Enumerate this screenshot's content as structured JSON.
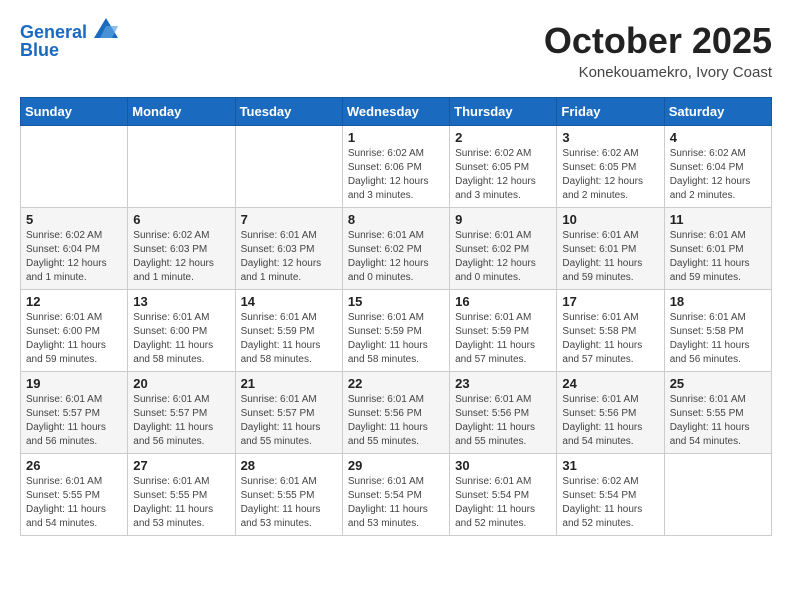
{
  "header": {
    "logo_line1": "General",
    "logo_line2": "Blue",
    "month": "October 2025",
    "location": "Konekouamekro, Ivory Coast"
  },
  "weekdays": [
    "Sunday",
    "Monday",
    "Tuesday",
    "Wednesday",
    "Thursday",
    "Friday",
    "Saturday"
  ],
  "weeks": [
    [
      {
        "day": "",
        "info": ""
      },
      {
        "day": "",
        "info": ""
      },
      {
        "day": "",
        "info": ""
      },
      {
        "day": "1",
        "info": "Sunrise: 6:02 AM\nSunset: 6:06 PM\nDaylight: 12 hours\nand 3 minutes."
      },
      {
        "day": "2",
        "info": "Sunrise: 6:02 AM\nSunset: 6:05 PM\nDaylight: 12 hours\nand 3 minutes."
      },
      {
        "day": "3",
        "info": "Sunrise: 6:02 AM\nSunset: 6:05 PM\nDaylight: 12 hours\nand 2 minutes."
      },
      {
        "day": "4",
        "info": "Sunrise: 6:02 AM\nSunset: 6:04 PM\nDaylight: 12 hours\nand 2 minutes."
      }
    ],
    [
      {
        "day": "5",
        "info": "Sunrise: 6:02 AM\nSunset: 6:04 PM\nDaylight: 12 hours\nand 1 minute."
      },
      {
        "day": "6",
        "info": "Sunrise: 6:02 AM\nSunset: 6:03 PM\nDaylight: 12 hours\nand 1 minute."
      },
      {
        "day": "7",
        "info": "Sunrise: 6:01 AM\nSunset: 6:03 PM\nDaylight: 12 hours\nand 1 minute."
      },
      {
        "day": "8",
        "info": "Sunrise: 6:01 AM\nSunset: 6:02 PM\nDaylight: 12 hours\nand 0 minutes."
      },
      {
        "day": "9",
        "info": "Sunrise: 6:01 AM\nSunset: 6:02 PM\nDaylight: 12 hours\nand 0 minutes."
      },
      {
        "day": "10",
        "info": "Sunrise: 6:01 AM\nSunset: 6:01 PM\nDaylight: 11 hours\nand 59 minutes."
      },
      {
        "day": "11",
        "info": "Sunrise: 6:01 AM\nSunset: 6:01 PM\nDaylight: 11 hours\nand 59 minutes."
      }
    ],
    [
      {
        "day": "12",
        "info": "Sunrise: 6:01 AM\nSunset: 6:00 PM\nDaylight: 11 hours\nand 59 minutes."
      },
      {
        "day": "13",
        "info": "Sunrise: 6:01 AM\nSunset: 6:00 PM\nDaylight: 11 hours\nand 58 minutes."
      },
      {
        "day": "14",
        "info": "Sunrise: 6:01 AM\nSunset: 5:59 PM\nDaylight: 11 hours\nand 58 minutes."
      },
      {
        "day": "15",
        "info": "Sunrise: 6:01 AM\nSunset: 5:59 PM\nDaylight: 11 hours\nand 58 minutes."
      },
      {
        "day": "16",
        "info": "Sunrise: 6:01 AM\nSunset: 5:59 PM\nDaylight: 11 hours\nand 57 minutes."
      },
      {
        "day": "17",
        "info": "Sunrise: 6:01 AM\nSunset: 5:58 PM\nDaylight: 11 hours\nand 57 minutes."
      },
      {
        "day": "18",
        "info": "Sunrise: 6:01 AM\nSunset: 5:58 PM\nDaylight: 11 hours\nand 56 minutes."
      }
    ],
    [
      {
        "day": "19",
        "info": "Sunrise: 6:01 AM\nSunset: 5:57 PM\nDaylight: 11 hours\nand 56 minutes."
      },
      {
        "day": "20",
        "info": "Sunrise: 6:01 AM\nSunset: 5:57 PM\nDaylight: 11 hours\nand 56 minutes."
      },
      {
        "day": "21",
        "info": "Sunrise: 6:01 AM\nSunset: 5:57 PM\nDaylight: 11 hours\nand 55 minutes."
      },
      {
        "day": "22",
        "info": "Sunrise: 6:01 AM\nSunset: 5:56 PM\nDaylight: 11 hours\nand 55 minutes."
      },
      {
        "day": "23",
        "info": "Sunrise: 6:01 AM\nSunset: 5:56 PM\nDaylight: 11 hours\nand 55 minutes."
      },
      {
        "day": "24",
        "info": "Sunrise: 6:01 AM\nSunset: 5:56 PM\nDaylight: 11 hours\nand 54 minutes."
      },
      {
        "day": "25",
        "info": "Sunrise: 6:01 AM\nSunset: 5:55 PM\nDaylight: 11 hours\nand 54 minutes."
      }
    ],
    [
      {
        "day": "26",
        "info": "Sunrise: 6:01 AM\nSunset: 5:55 PM\nDaylight: 11 hours\nand 54 minutes."
      },
      {
        "day": "27",
        "info": "Sunrise: 6:01 AM\nSunset: 5:55 PM\nDaylight: 11 hours\nand 53 minutes."
      },
      {
        "day": "28",
        "info": "Sunrise: 6:01 AM\nSunset: 5:55 PM\nDaylight: 11 hours\nand 53 minutes."
      },
      {
        "day": "29",
        "info": "Sunrise: 6:01 AM\nSunset: 5:54 PM\nDaylight: 11 hours\nand 53 minutes."
      },
      {
        "day": "30",
        "info": "Sunrise: 6:01 AM\nSunset: 5:54 PM\nDaylight: 11 hours\nand 52 minutes."
      },
      {
        "day": "31",
        "info": "Sunrise: 6:02 AM\nSunset: 5:54 PM\nDaylight: 11 hours\nand 52 minutes."
      },
      {
        "day": "",
        "info": ""
      }
    ]
  ]
}
